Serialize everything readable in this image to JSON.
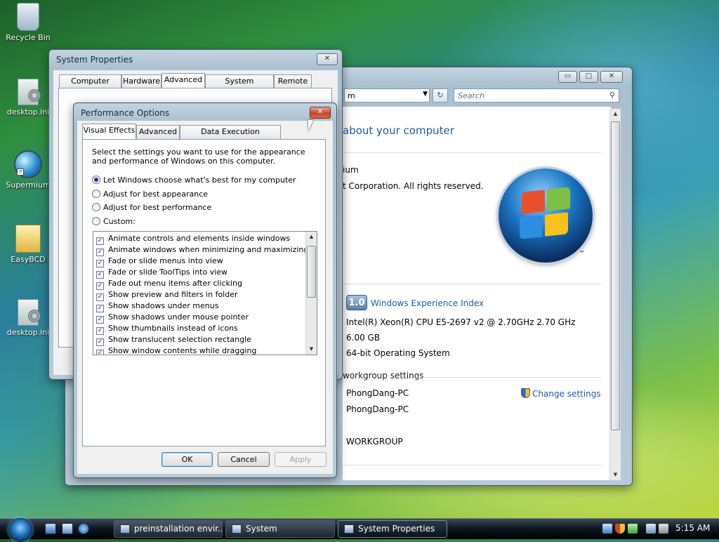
{
  "desktop": {
    "icons": [
      {
        "label": "Recycle Bin",
        "icon": "recycle-bin-icon"
      },
      {
        "label": "desktop.ini",
        "icon": "settings-file-icon"
      },
      {
        "label": "Supermium",
        "icon": "browser-icon"
      },
      {
        "label": "EasyBCD",
        "icon": "folder-icon"
      },
      {
        "label": "desktop.ini",
        "icon": "settings-file-icon"
      }
    ]
  },
  "system_window": {
    "title": "System",
    "address": "m",
    "search_placeholder": "Search",
    "heading": "about your computer",
    "edition_partial": "ium",
    "copyright": "t Corporation.  All rights reserved.",
    "rating_badge": "1.0",
    "rating_link": "Windows Experience Index",
    "processor": "Intel(R) Xeon(R) CPU E5-2697 v2 @ 2.70GHz   2.70 GHz",
    "memory": "6.00 GB",
    "system_type": "64-bit Operating System",
    "section_workgroup": "workgroup settings",
    "computer_name": "PhongDang-PC",
    "full_computer_name": "PhongDang-PC",
    "workgroup": "WORKGROUP",
    "change_settings": "Change settings",
    "logo_tm": "™",
    "help_glyph": "?"
  },
  "system_properties": {
    "title": "System Properties",
    "tabs": [
      "Computer Name",
      "Hardware",
      "Advanced",
      "System Protection",
      "Remote"
    ],
    "active_tab": "Advanced",
    "close_glyph": "✕"
  },
  "performance_options": {
    "title": "Performance Options",
    "close_glyph": "✕",
    "tabs": [
      "Visual Effects",
      "Advanced",
      "Data Execution Prevention"
    ],
    "active_tab": "Visual Effects",
    "description": "Select the settings you want to use for the appearance and performance of Windows on this computer.",
    "radios": [
      {
        "label": "Let Windows choose what's best for my computer",
        "selected": true
      },
      {
        "label": "Adjust for best appearance",
        "selected": false
      },
      {
        "label": "Adjust for best performance",
        "selected": false
      },
      {
        "label": "Custom:",
        "selected": false
      }
    ],
    "effects": [
      "Animate controls and elements inside windows",
      "Animate windows when minimizing and maximizing",
      "Fade or slide menus into view",
      "Fade or slide ToolTips into view",
      "Fade out menu items after clicking",
      "Show preview and filters in folder",
      "Show shadows under menus",
      "Show shadows under mouse pointer",
      "Show thumbnails instead of icons",
      "Show translucent selection rectangle",
      "Show window contents while dragging"
    ],
    "check_glyph": "✓",
    "buttons": {
      "ok": "OK",
      "cancel": "Cancel",
      "apply": "Apply"
    }
  },
  "taskbar": {
    "buttons": [
      "preinstallation envir...",
      "System",
      "System Properties"
    ],
    "active_button": "System Properties",
    "clock": "5:15 AM"
  },
  "colors": {
    "link_blue": "#1d5ca8",
    "close_red": "#c8442c"
  }
}
